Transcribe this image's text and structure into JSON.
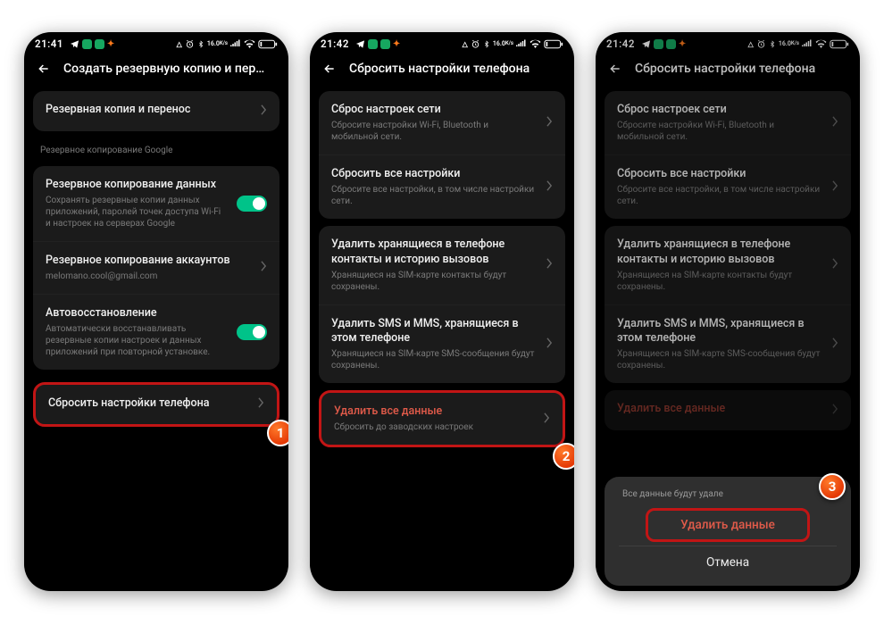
{
  "screens": [
    {
      "status": {
        "time": "21:41"
      },
      "title": "Создать резервную копию и перезаг..",
      "row_backup_transfer": "Резервная копия и перенос",
      "section_google_label": "Резервное копирование Google",
      "row_data_backup": {
        "main": "Резервное копирование данных",
        "sub": "Сохранять резервные копии данных приложений, паролей точек доступа Wi-Fi и настроек на серверах Google"
      },
      "row_account_backup": {
        "main": "Резервное копирование аккаунтов",
        "sub": "melomano.cool@gmail.com"
      },
      "row_autorestore": {
        "main": "Автовосстановление",
        "sub": "Автоматически восстанавливать резервные копии настроек и данных приложений при повторной установке."
      },
      "row_reset": {
        "main": "Сбросить настройки телефона"
      },
      "badge": "1"
    },
    {
      "status": {
        "time": "21:42"
      },
      "title": "Сбросить настройки телефона",
      "row_net": {
        "main": "Сброс настроек сети",
        "sub": "Сбросите настройки Wi-Fi, Bluetooth и мобильной сети."
      },
      "row_all": {
        "main": "Сбросить все настройки",
        "sub": "Сбросите все настройки, в том числе настройки сети."
      },
      "row_contacts": {
        "main": "Удалить хранящиеся в телефоне контакты и историю вызовов",
        "sub": "Хранящиеся на SIM-карте контакты будут сохранены."
      },
      "row_sms": {
        "main": "Удалить SMS и MMS, хранящиеся в этом телефоне",
        "sub": "Хранящиеся на SIM-карте SMS-сообщения будут сохранены."
      },
      "row_erase": {
        "main": "Удалить все данные",
        "sub": "Сбросить до заводских настроек"
      },
      "badge": "2"
    },
    {
      "status": {
        "time": "21:42"
      },
      "title": "Сбросить настройки телефона",
      "row_net": {
        "main": "Сброс настроек сети",
        "sub": "Сбросите настройки Wi-Fi, Bluetooth и мобильной сети."
      },
      "row_all": {
        "main": "Сбросить все настройки",
        "sub": "Сбросите все настройки, в том числе настройки сети."
      },
      "row_contacts": {
        "main": "Удалить хранящиеся в телефоне контакты и историю вызовов",
        "sub": "Хранящиеся на SIM-карте контакты будут сохранены."
      },
      "row_sms": {
        "main": "Удалить SMS и MMS, хранящиеся в этом телефоне",
        "sub": "Хранящиеся на SIM-карте SMS-сообщения будут сохранены."
      },
      "row_erase": {
        "main": "Удалить все данные"
      },
      "sheet": {
        "note": "Все данные будут удале",
        "confirm": "Удалить данные",
        "cancel": "Отмена"
      },
      "badge": "3"
    }
  ],
  "status_icons": {
    "kbps": "16.0",
    "kbps_unit": "K/s"
  }
}
